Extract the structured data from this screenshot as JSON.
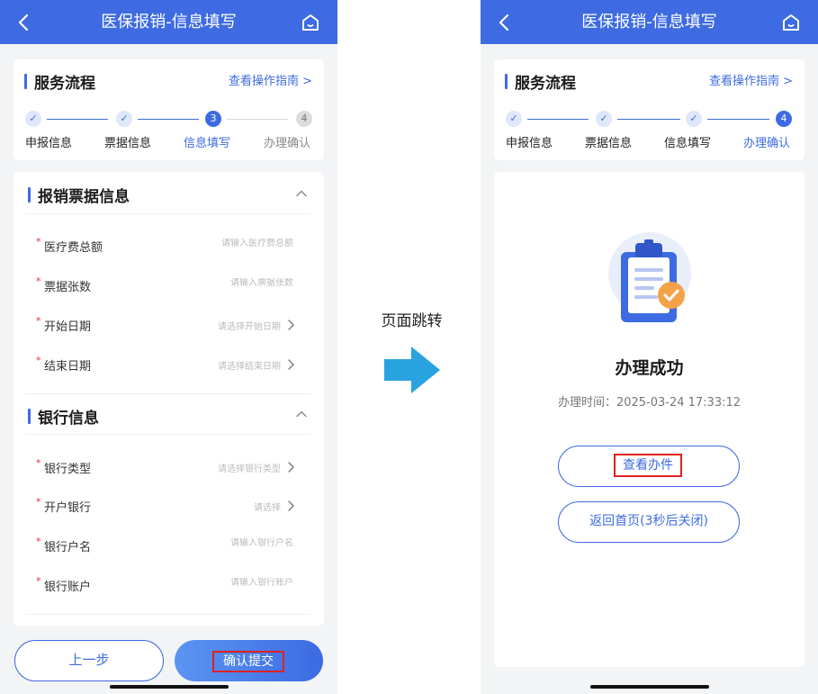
{
  "colors": {
    "primary": "#3e6be1",
    "required": "#e02020",
    "highlight_box": "#e02020",
    "arrow": "#29a3e0"
  },
  "left_screen": {
    "nav": {
      "title": "医保报销-信息填写",
      "back_icon": "chevron-left-icon",
      "home_icon": "home-icon"
    },
    "flow": {
      "title": "服务流程",
      "guide_link": "查看操作指南 >",
      "steps": [
        {
          "label": "申报信息",
          "marker": "✓",
          "state": "done"
        },
        {
          "label": "票据信息",
          "marker": "✓",
          "state": "done"
        },
        {
          "label": "信息填写",
          "marker": "3",
          "state": "active"
        },
        {
          "label": "办理确认",
          "marker": "4",
          "state": "todo"
        }
      ]
    },
    "invoice_section": {
      "title": "报销票据信息",
      "fields": [
        {
          "label": "医疗费总额",
          "placeholder": "请输入医疗费总额",
          "type": "input",
          "required": "*"
        },
        {
          "label": "票据张数",
          "placeholder": "请输入票据张数",
          "type": "input",
          "required": "*"
        },
        {
          "label": "开始日期",
          "placeholder": "请选择开始日期",
          "type": "select",
          "required": "*"
        },
        {
          "label": "结束日期",
          "placeholder": "请选择结束日期",
          "type": "select",
          "required": "*"
        }
      ]
    },
    "bank_section": {
      "title": "银行信息",
      "fields": [
        {
          "label": "银行类型",
          "placeholder": "请选择银行类型",
          "type": "select",
          "required": "*"
        },
        {
          "label": "开户银行",
          "placeholder": "请选择",
          "type": "select",
          "required": "*"
        },
        {
          "label": "银行户名",
          "placeholder": "请输入银行户名",
          "type": "input",
          "required": "*"
        },
        {
          "label": "银行账户",
          "placeholder": "请输入银行账户",
          "type": "input",
          "required": "*"
        }
      ]
    },
    "buttons": {
      "prev": "上一步",
      "submit": "确认提交"
    }
  },
  "transition": {
    "label": "页面跳转",
    "icon": "right-arrow-icon"
  },
  "right_screen": {
    "nav": {
      "title": "医保报销-信息填写",
      "back_icon": "chevron-left-icon",
      "home_icon": "home-icon"
    },
    "flow": {
      "title": "服务流程",
      "guide_link": "查看操作指南 >",
      "steps": [
        {
          "label": "申报信息",
          "marker": "✓",
          "state": "done"
        },
        {
          "label": "票据信息",
          "marker": "✓",
          "state": "done"
        },
        {
          "label": "信息填写",
          "marker": "✓",
          "state": "done"
        },
        {
          "label": "办理确认",
          "marker": "4",
          "state": "active"
        }
      ]
    },
    "result": {
      "illustration": "clipboard-success-icon",
      "title": "办理成功",
      "time": "办理时间：2025-03-24 17:33:12"
    },
    "buttons": {
      "view": "查看办件",
      "back_home": "返回首页(3秒后关闭)"
    }
  }
}
